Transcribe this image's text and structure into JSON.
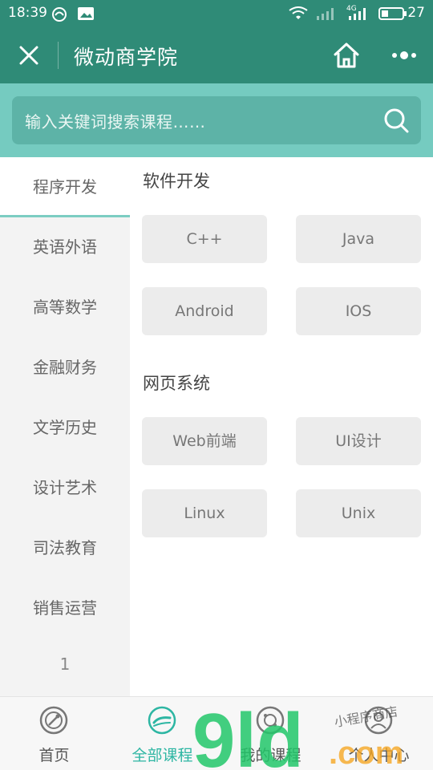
{
  "status_bar": {
    "time": "18:39",
    "network": "4G",
    "battery": "27",
    "colors": {
      "bar": "#2f8b77"
    }
  },
  "title_bar": {
    "title": "微动商学院",
    "close_icon": "close-icon",
    "home_icon": "home-icon",
    "more_icon": "more-icon"
  },
  "search": {
    "placeholder": "输入关键词搜索课程……",
    "icon": "search-icon"
  },
  "sidebar": {
    "items": [
      {
        "label": "程序开发",
        "active": true
      },
      {
        "label": "英语外语",
        "active": false
      },
      {
        "label": "高等数学",
        "active": false
      },
      {
        "label": "金融财务",
        "active": false
      },
      {
        "label": "文学历史",
        "active": false
      },
      {
        "label": "设计艺术",
        "active": false
      },
      {
        "label": "司法教育",
        "active": false
      },
      {
        "label": "销售运营",
        "active": false
      }
    ],
    "page_number": "1"
  },
  "content": {
    "sections": [
      {
        "title": "软件开发",
        "tags": [
          "C++",
          "Java",
          "Android",
          "IOS"
        ]
      },
      {
        "title": "网页系统",
        "tags": [
          "Web前端",
          "UI设计",
          "Linux",
          "Unix"
        ]
      }
    ]
  },
  "bottom_nav": {
    "items": [
      {
        "label": "首页",
        "icon": "home-globe-icon",
        "active": false
      },
      {
        "label": "全部课程",
        "icon": "all-courses-icon",
        "active": true
      },
      {
        "label": "我的课程",
        "icon": "my-courses-icon",
        "active": false
      },
      {
        "label": "个人中心",
        "icon": "profile-icon",
        "active": false
      }
    ]
  },
  "watermark": {
    "text": "9ld.com",
    "subtext": "小程序商店"
  },
  "colors": {
    "primary": "#2f8b77",
    "search_bg": "#75cbc0",
    "accent": "#2db6a3"
  }
}
